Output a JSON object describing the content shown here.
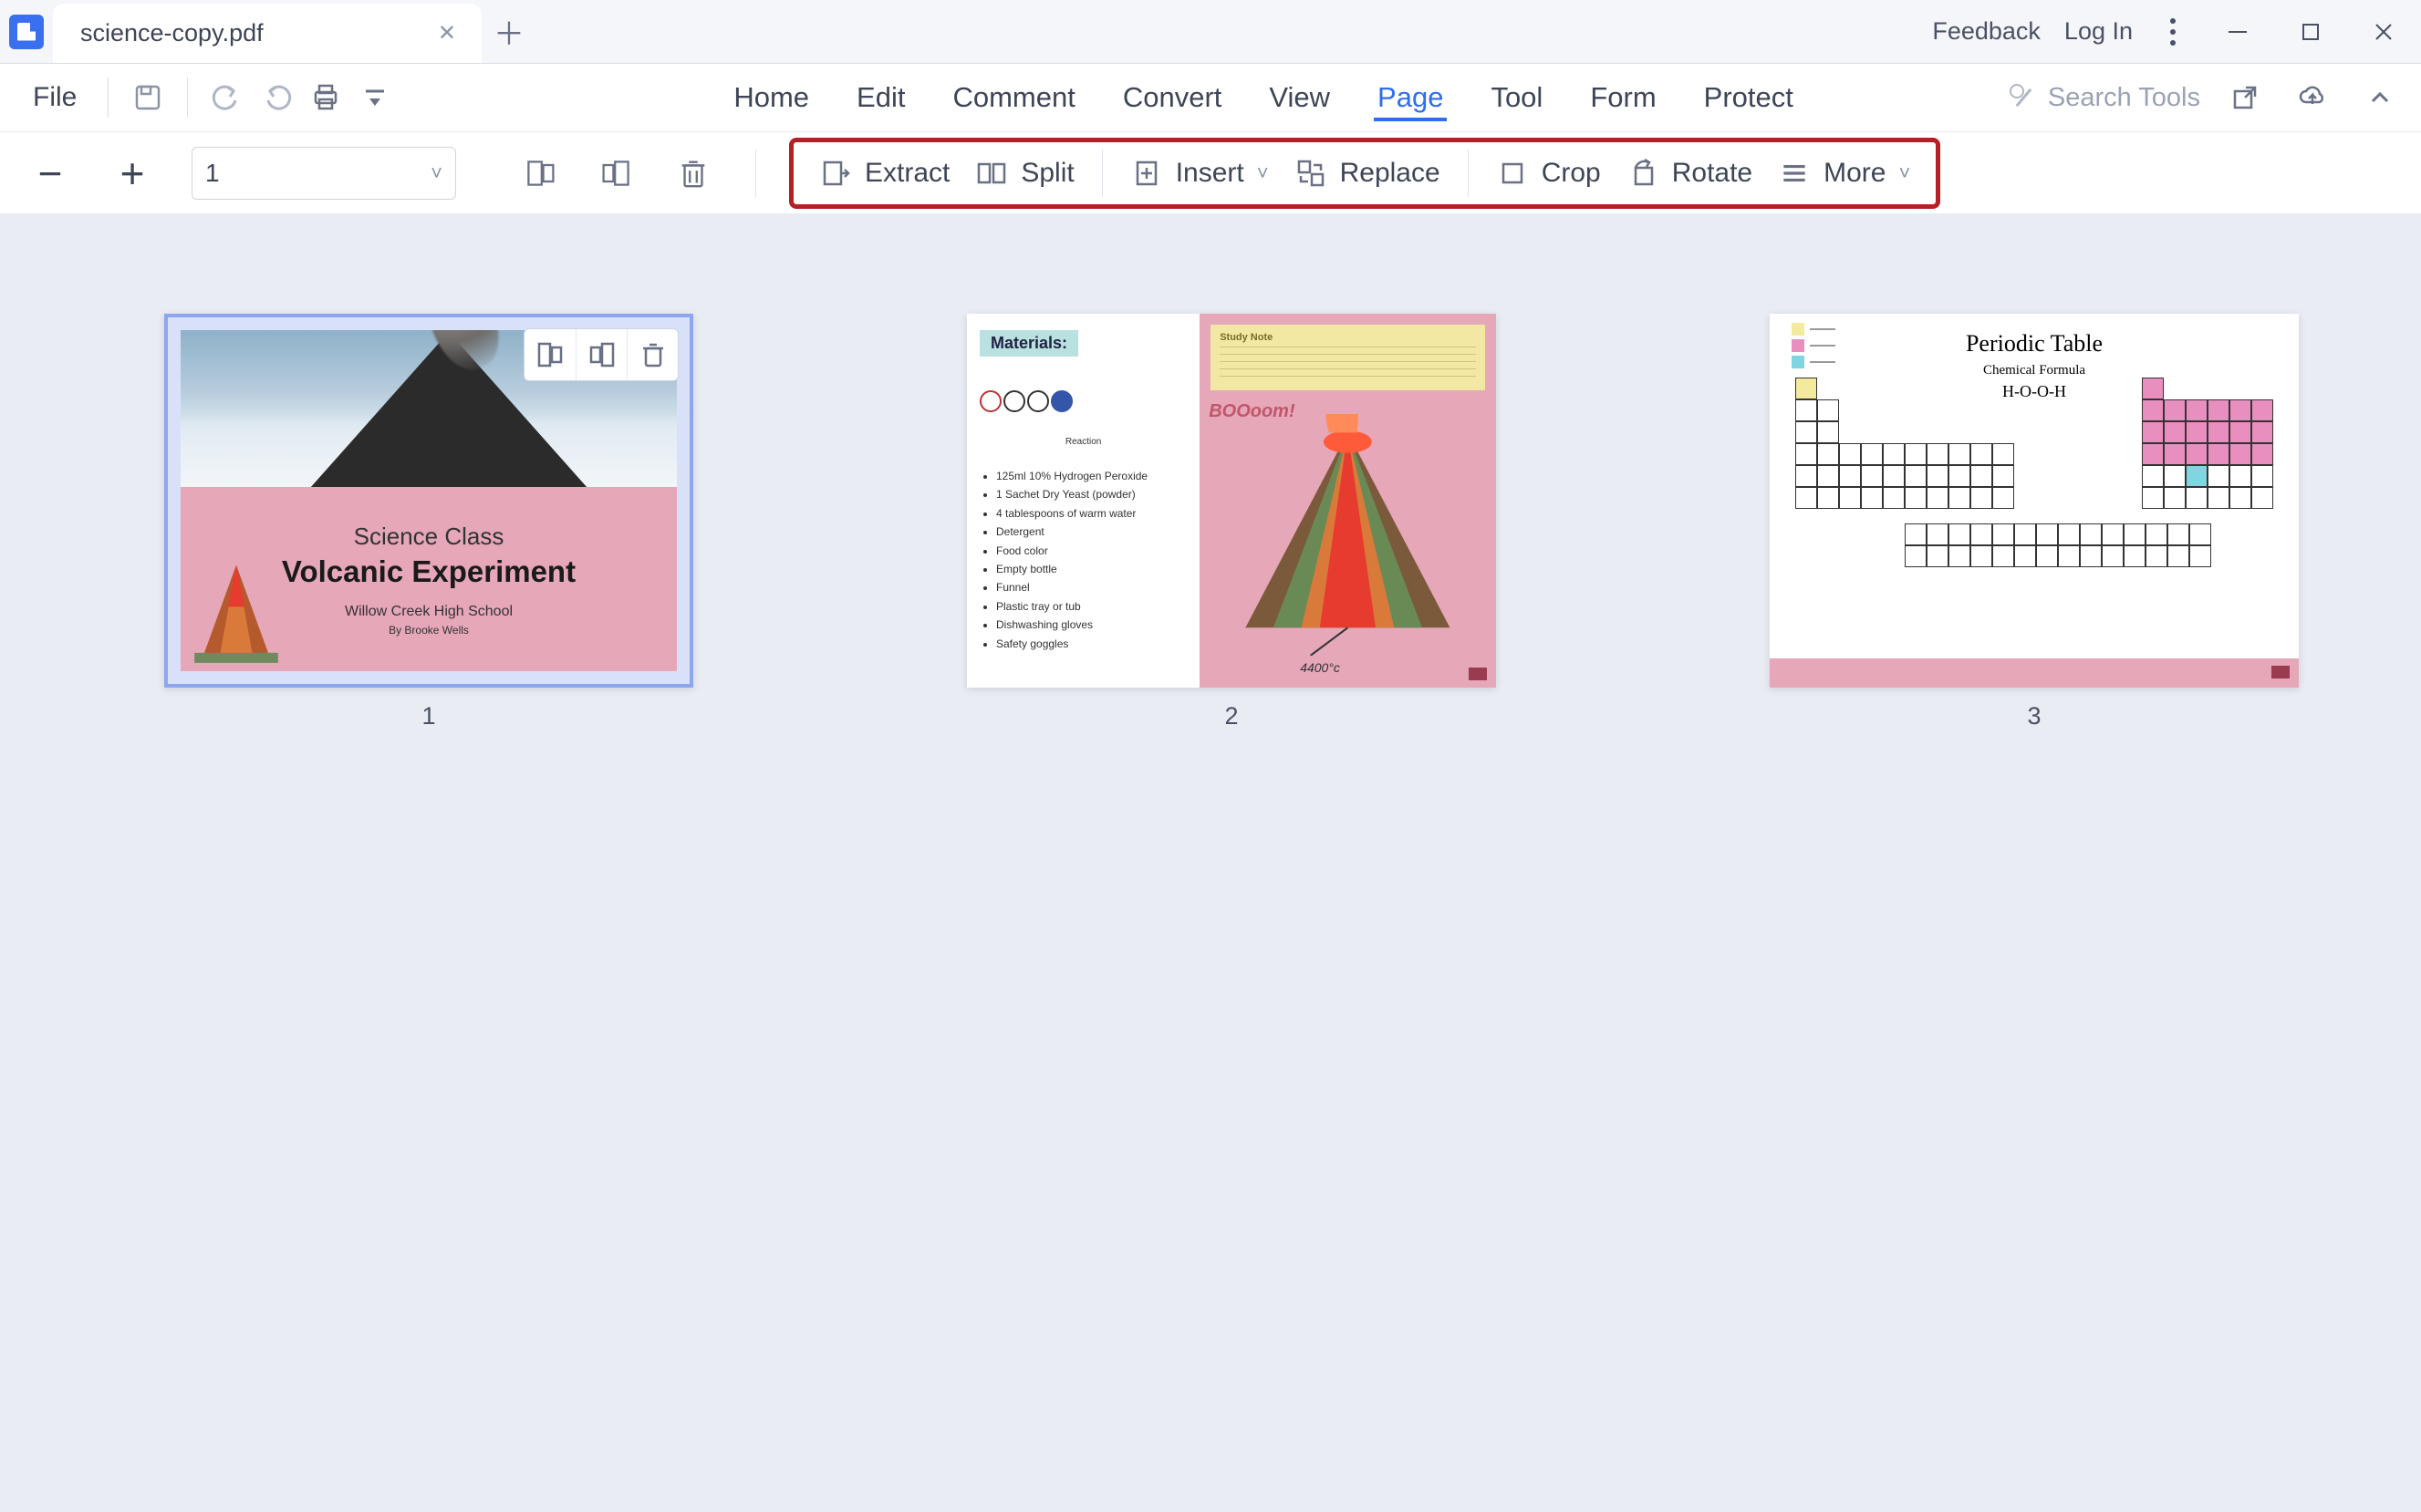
{
  "titlebar": {
    "tab_title": "science-copy.pdf",
    "feedback": "Feedback",
    "login": "Log In"
  },
  "menubar": {
    "file": "File",
    "items": [
      "Home",
      "Edit",
      "Comment",
      "Convert",
      "View",
      "Page",
      "Tool",
      "Form",
      "Protect"
    ],
    "active_index": 5,
    "search_placeholder": "Search Tools"
  },
  "toolbar": {
    "zoom_value": "1",
    "extract": "Extract",
    "split": "Split",
    "insert": "Insert",
    "replace": "Replace",
    "crop": "Crop",
    "rotate": "Rotate",
    "more": "More"
  },
  "pages": [
    {
      "num": "1",
      "selected": true,
      "title1": "Science Class",
      "title2": "Volcanic Experiment",
      "subtitle": "Willow Creek High School",
      "byline": "By Brooke Wells"
    },
    {
      "num": "2",
      "badge": "Materials:",
      "reaction_label": "Reaction",
      "note_title": "Study Note",
      "boom": "BOOoom!",
      "temp": "4400°c",
      "materials": [
        "125ml 10% Hydrogen Peroxide",
        "1 Sachet Dry Yeast (powder)",
        "4 tablespoons of warm water",
        "Detergent",
        "Food color",
        "Empty bottle",
        "Funnel",
        "Plastic tray or tub",
        "Dishwashing gloves",
        "Safety goggles"
      ]
    },
    {
      "num": "3",
      "title": "Periodic Table",
      "subtitle": "Chemical Formula",
      "formula": "H-O-O-H"
    }
  ]
}
